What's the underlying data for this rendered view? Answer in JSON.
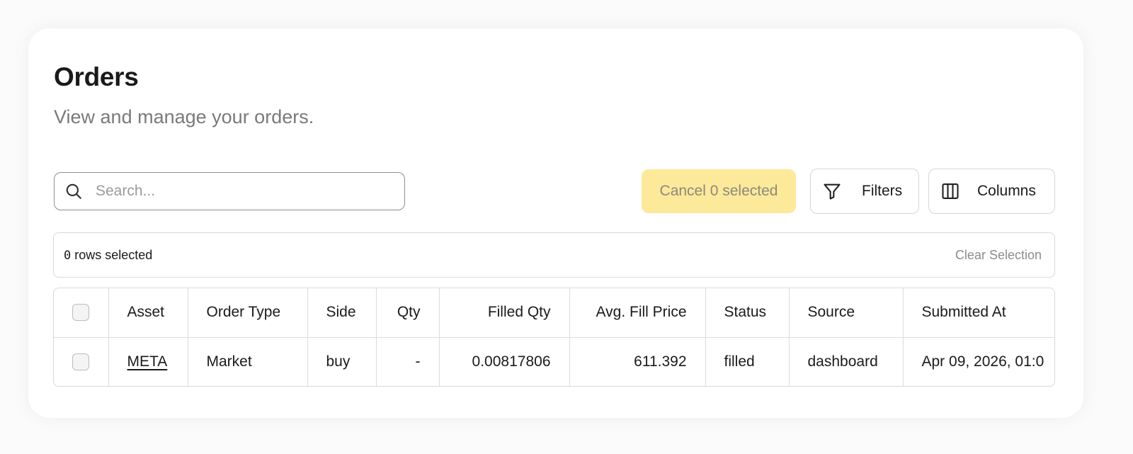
{
  "header": {
    "title": "Orders",
    "subtitle": "View and manage your orders."
  },
  "toolbar": {
    "search_placeholder": "Search...",
    "search_value": "",
    "cancel_label": "Cancel 0 selected",
    "filters_label": "Filters",
    "columns_label": "Columns",
    "icons": {
      "search": "search-icon",
      "filters": "filter-funnel-icon",
      "columns": "columns-icon"
    }
  },
  "selection": {
    "count": "0",
    "suffix": " rows selected",
    "clear_label": "Clear Selection"
  },
  "table": {
    "columns": [
      "Asset",
      "Order Type",
      "Side",
      "Qty",
      "Filled Qty",
      "Avg. Fill Price",
      "Status",
      "Source",
      "Submitted At"
    ],
    "rows": [
      {
        "asset": "META",
        "order_type": "Market",
        "side": "buy",
        "qty": "-",
        "filled_qty": "0.00817806",
        "avg_fill_price": "611.392",
        "status": "filled",
        "source": "dashboard",
        "submitted_at": "Apr 09, 2026, 01:0"
      }
    ]
  },
  "colors": {
    "cancel_bg": "#fde99a",
    "border": "#d9d9d9",
    "muted_text": "#7a7a7a"
  }
}
